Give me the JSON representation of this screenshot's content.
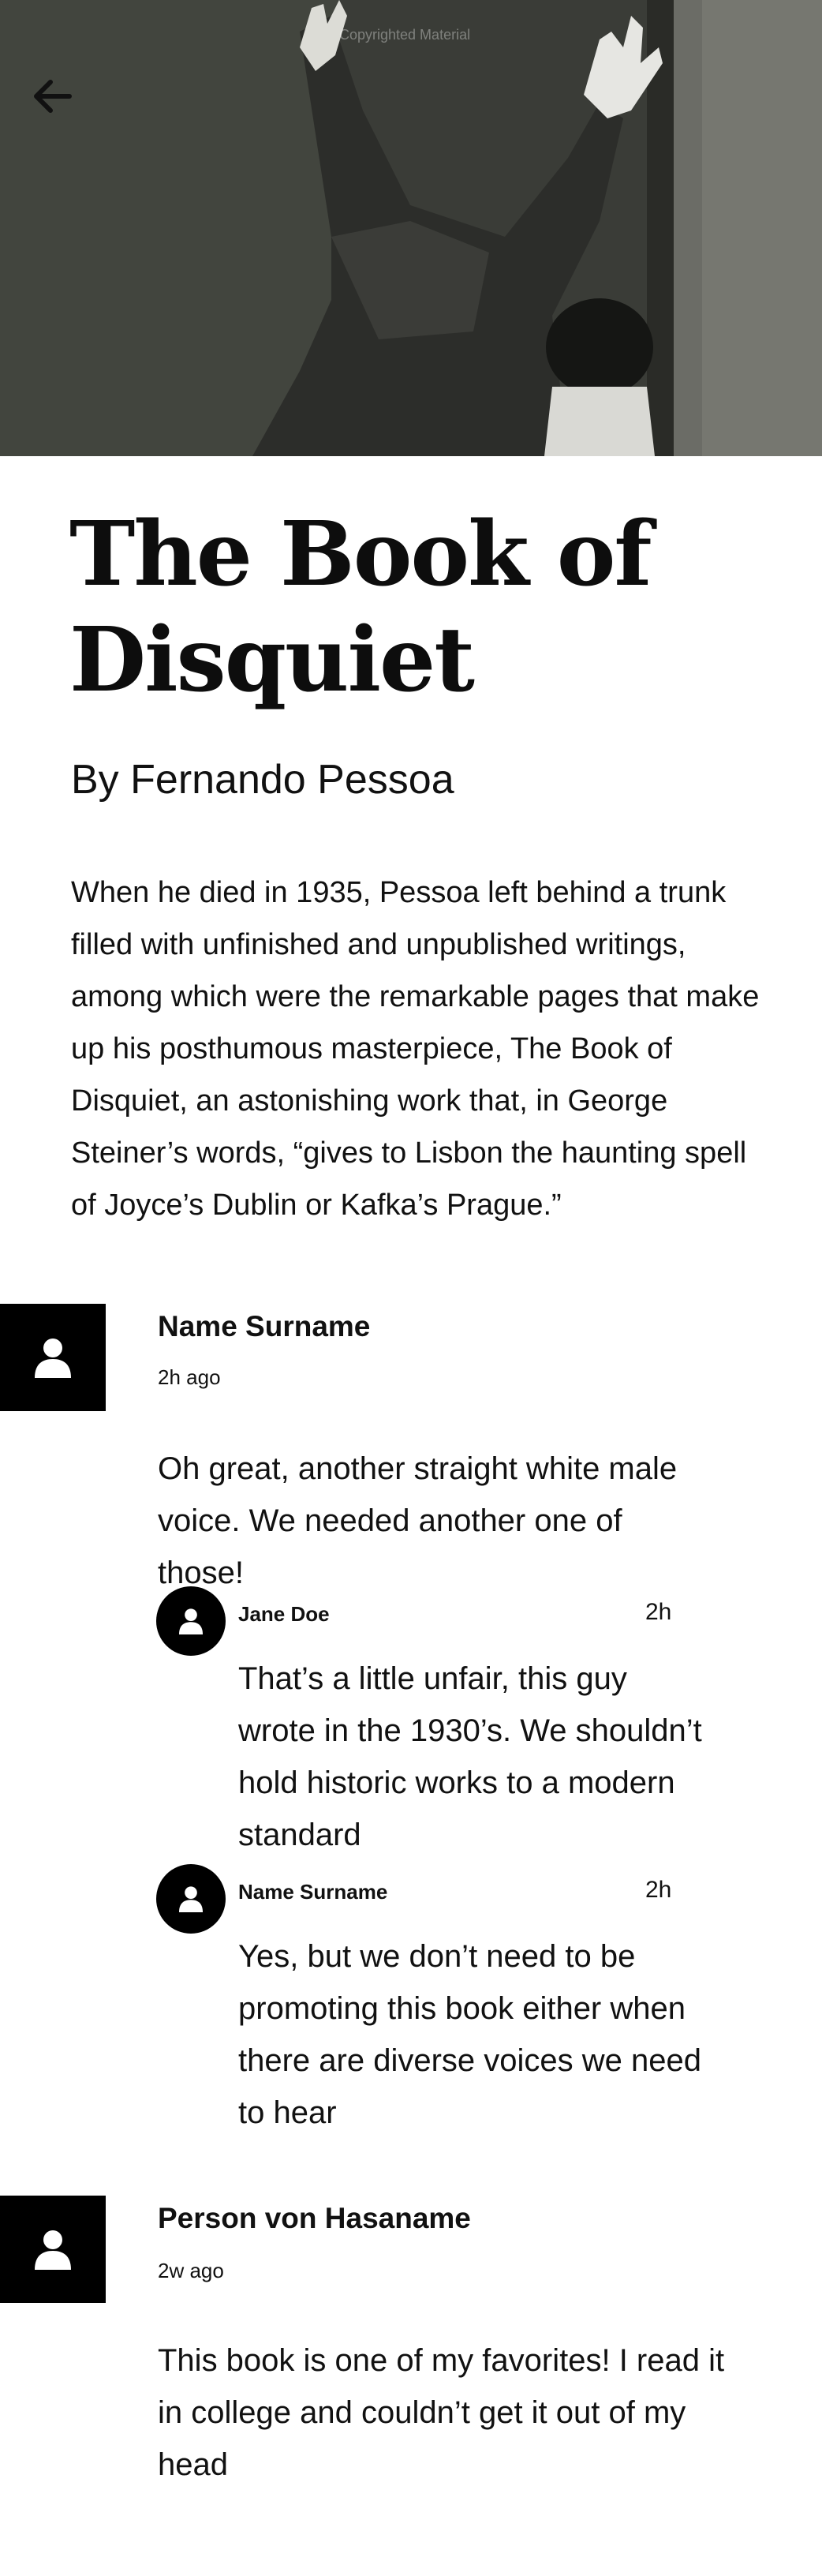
{
  "hero": {
    "watermark": "Copyrighted Material",
    "image_icon": "man-reaching-photo"
  },
  "nav": {
    "back_icon": "arrow-left-icon"
  },
  "book": {
    "title_line1": "The Book of",
    "title_line2": "Disquiet",
    "author": "By Fernando Pessoa",
    "description": "When he died in 1935, Pessoa left behind a trunk filled with unfinished and unpublished writings, among which were the remarkable pages that make up his posthumous masterpiece, The Book of Disquiet, an astonishing work that, in George Steiner’s words, “gives to Lisbon the haunting spell of Joyce’s Dublin or Kafka’s Prague.”"
  },
  "comments": [
    {
      "name": "Name Surname",
      "time": "2h ago",
      "text": "Oh great, another straight white male voice. We needed another one of those!",
      "replies": [
        {
          "name": "Jane Doe",
          "time": "2h",
          "text": "That’s a little unfair, this guy wrote in the 1930’s. We shouldn’t hold historic works to a modern standard"
        },
        {
          "name": "Name Surname",
          "time": "2h",
          "text": "Yes, but we don’t need to be promoting this book either when there are diverse voices we need to hear"
        }
      ]
    },
    {
      "name": "Person von Hasaname",
      "time": "2w ago",
      "text": "This book is one of my favorites! I read it in college and couldn’t get it out of my head"
    }
  ],
  "colors": {
    "text": "#111111",
    "avatar_bg": "#000000",
    "background": "#ffffff"
  }
}
